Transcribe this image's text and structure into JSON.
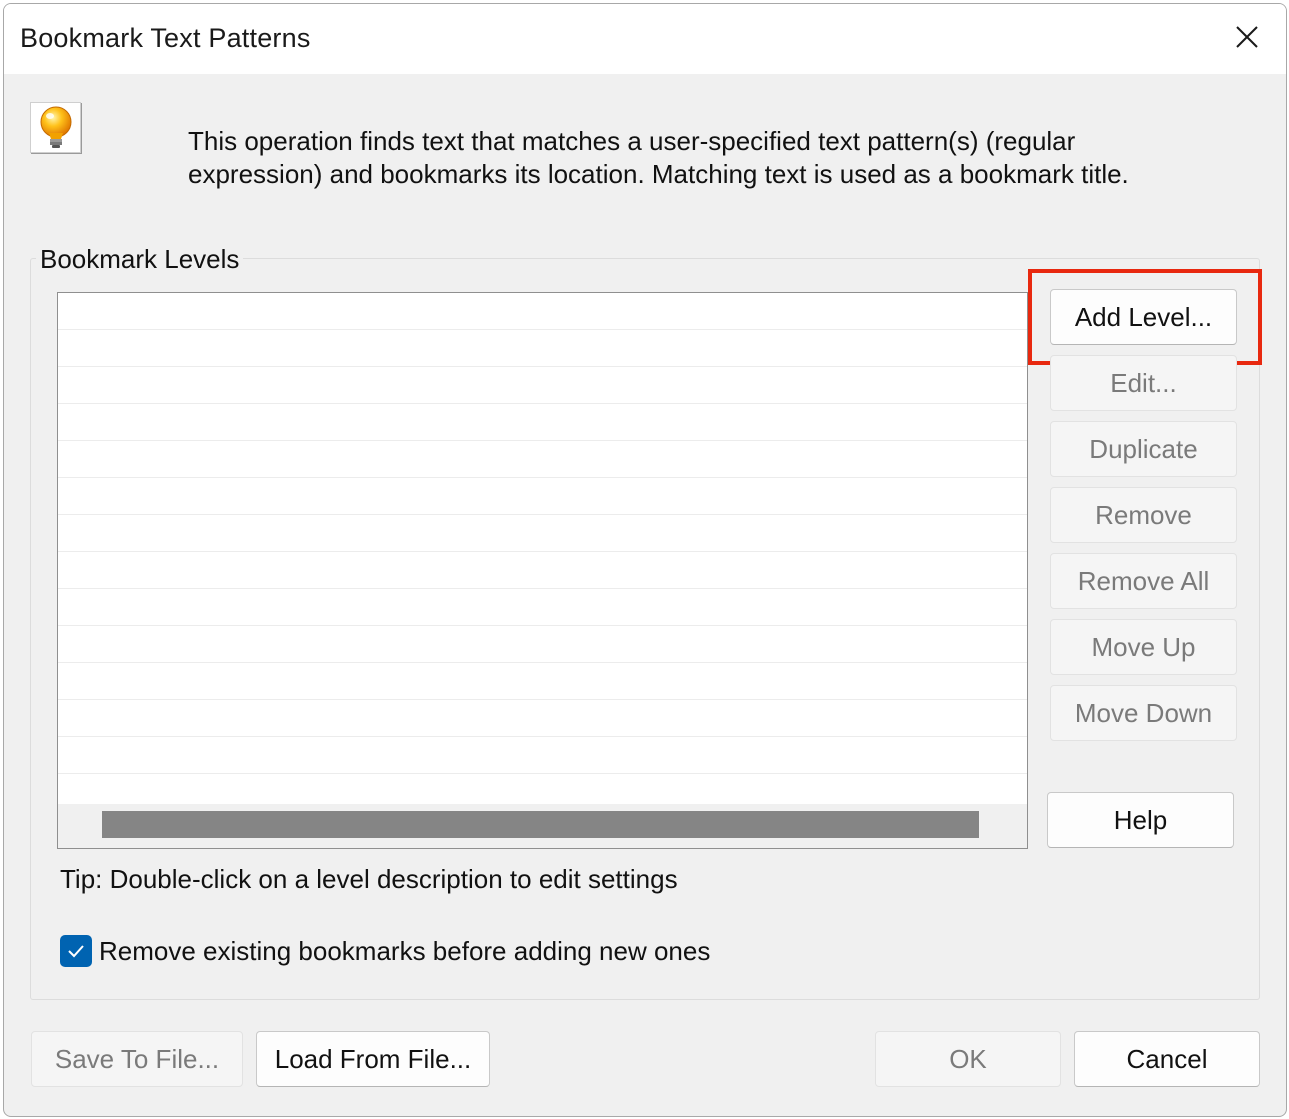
{
  "window": {
    "title": "Bookmark Text Patterns"
  },
  "description": "This operation finds text that matches a user-specified text pattern(s) (regular expression) and bookmarks its location. Matching text is used as a bookmark title.",
  "levels_group": {
    "label": "Bookmark Levels",
    "rows": 14
  },
  "side_buttons": {
    "add_level": "Add Level...",
    "edit": "Edit...",
    "duplicate": "Duplicate",
    "remove": "Remove",
    "remove_all": "Remove All",
    "move_up": "Move Up",
    "move_down": "Move Down",
    "help": "Help"
  },
  "tip": "Tip: Double-click on a level description to edit settings",
  "remove_existing": {
    "label": "Remove existing bookmarks before adding new ones",
    "checked": true
  },
  "footer": {
    "save_to_file": "Save To File...",
    "load_from_file": "Load From File...",
    "ok": "OK",
    "cancel": "Cancel"
  },
  "colors": {
    "highlight": "#e8280f",
    "checkbox_accent": "#0063b1"
  }
}
